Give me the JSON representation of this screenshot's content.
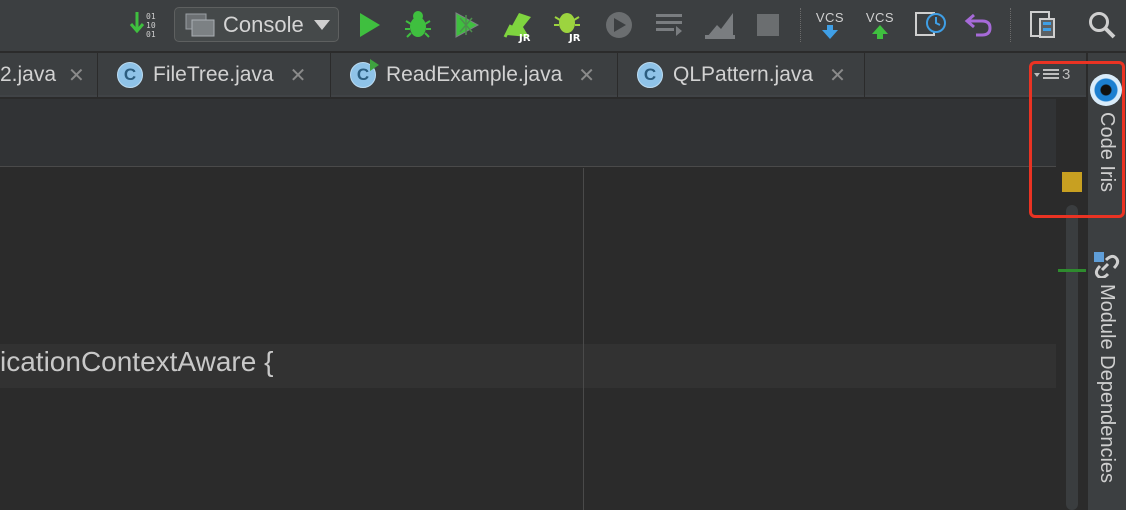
{
  "toolbar": {
    "run_config_label": "Console",
    "vcs_update_label": "VCS",
    "vcs_commit_label": "VCS",
    "icons": [
      "binary-sort-icon",
      "run-icon",
      "debug-icon",
      "coverage-icon",
      "jrebel-run-icon",
      "jrebel-debug-icon",
      "stop-circle-icon",
      "tasks-icon",
      "profiler-icon",
      "stop-icon",
      "vcs-update-icon",
      "vcs-commit-icon",
      "history-icon",
      "revert-icon",
      "project-structure-icon",
      "search-icon"
    ]
  },
  "tabs": [
    {
      "label": "2.java",
      "icon": "none",
      "close": "✕"
    },
    {
      "label": "FileTree.java",
      "icon": "class-icon",
      "close": "✕"
    },
    {
      "label": "ReadExample.java",
      "icon": "runnable-class-icon",
      "close": "✕"
    },
    {
      "label": "QLPattern.java",
      "icon": "class-icon",
      "close": "✕"
    }
  ],
  "tab_count": "3",
  "editor": {
    "code_line": "icationContextAware {"
  },
  "right_bar": {
    "code_iris_label": "Code Iris",
    "module_deps_label": "Module Dependencies"
  },
  "colors": {
    "highlight": "#ea3323",
    "warning_marker": "#c8a021",
    "change_marker": "#2e8b2e",
    "toolbar_bg": "#3c3f41",
    "editor_bg": "#2b2b2b"
  }
}
